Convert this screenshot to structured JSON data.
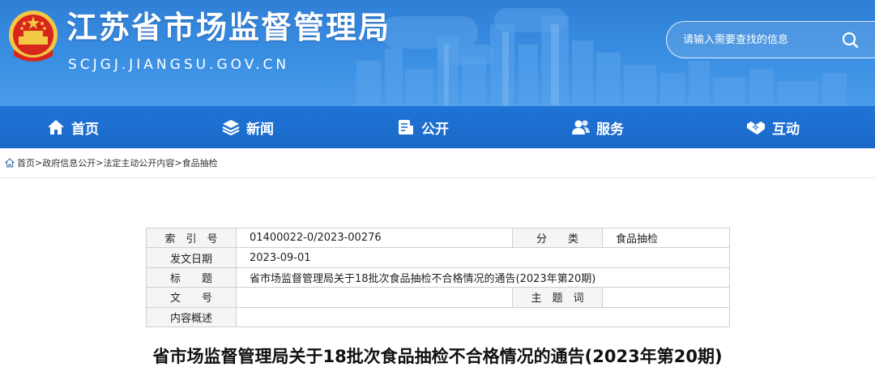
{
  "header": {
    "site_title": "江苏省市场监督管理局",
    "site_url": "SCJGJ.JIANGSU.GOV.CN",
    "search_placeholder": "请输入需要查找的信息"
  },
  "nav": {
    "items": [
      {
        "label": "首页",
        "icon": "home-icon"
      },
      {
        "label": "新闻",
        "icon": "layers-icon"
      },
      {
        "label": "公开",
        "icon": "document-icon"
      },
      {
        "label": "服务",
        "icon": "users-icon"
      },
      {
        "label": "互动",
        "icon": "handshake-icon"
      }
    ]
  },
  "breadcrumb": {
    "items": [
      "首页",
      "政府信息公开",
      "法定主动公开内容",
      "食品抽检"
    ],
    "separator": ">"
  },
  "info_table": {
    "index_label": "索　引　号",
    "index_value": "01400022-0/2023-00276",
    "category_label": "分　　类",
    "category_value": "食品抽检",
    "date_label": "发文日期",
    "date_value": "2023-09-01",
    "title_label": "标　　题",
    "title_value": "省市场监督管理局关于18批次食品抽检不合格情况的通告(2023年第20期)",
    "doc_no_label": "文　　号",
    "doc_no_value": "",
    "keywords_label": "主　题　词",
    "keywords_value": "",
    "summary_label": "内容概述",
    "summary_value": ""
  },
  "article": {
    "title": "省市场监督管理局关于18批次食品抽检不合格情况的通告(2023年第20期)"
  },
  "colors": {
    "header_blue": "#3a8fe3",
    "nav_blue": "#1d6fcf",
    "emblem_red": "#d9261c",
    "emblem_gold": "#f3c844"
  }
}
